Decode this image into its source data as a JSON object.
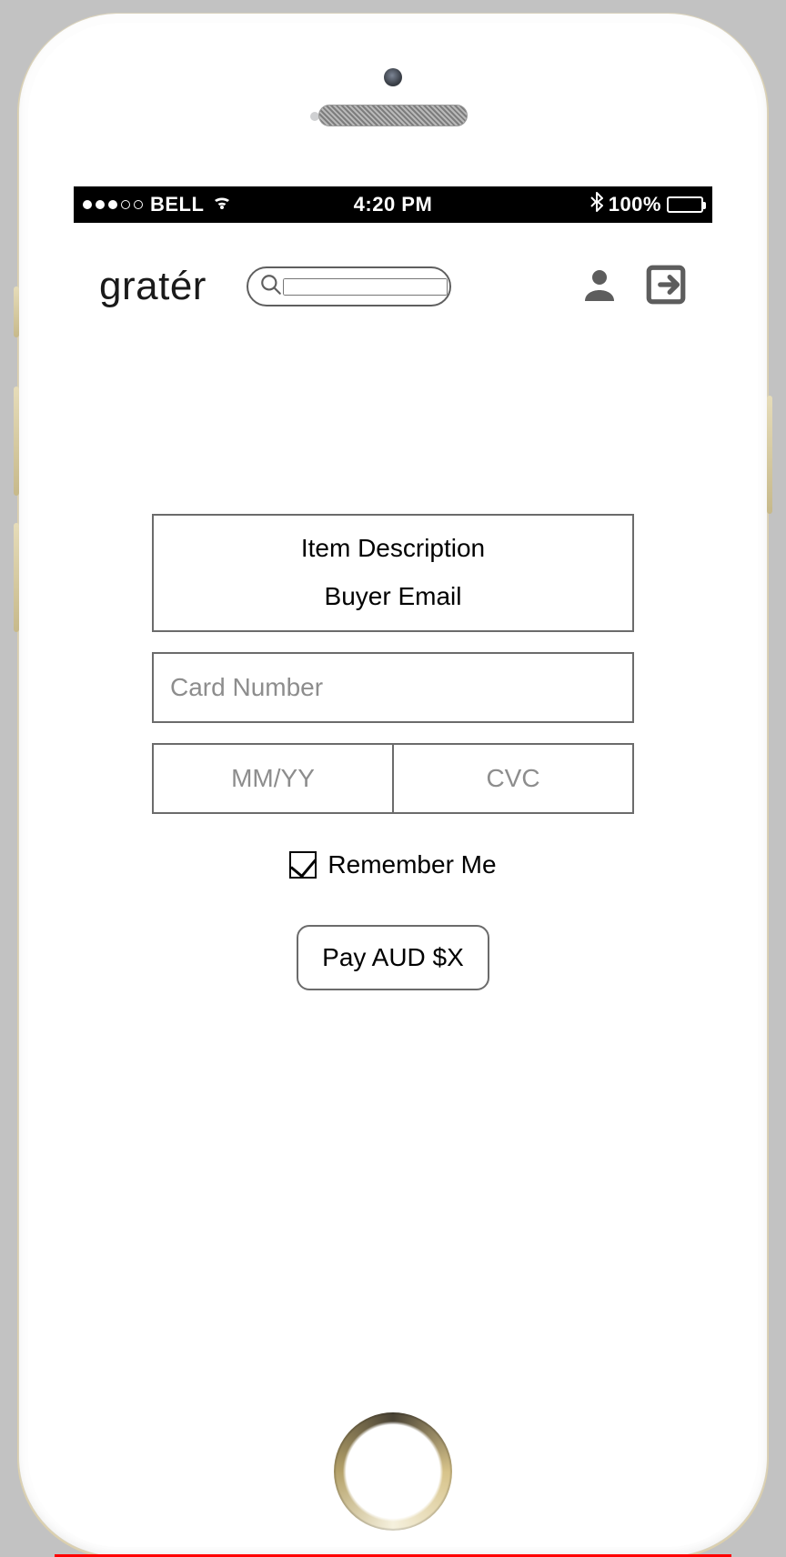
{
  "status": {
    "carrier": "BELL",
    "time": "4:20 PM",
    "battery_pct": "100%",
    "signal_filled": 3,
    "signal_total": 5
  },
  "header": {
    "brand": "gratér",
    "search_placeholder": "",
    "icons": {
      "user": "person-icon",
      "exit": "exit-icon",
      "search": "search-icon",
      "wifi": "wifi-icon",
      "bluetooth": "bluetooth-icon"
    }
  },
  "checkout": {
    "info_line_1": "Item Description",
    "info_line_2": "Buyer Email",
    "card_placeholder": "Card Number",
    "expiry_placeholder": "MM/YY",
    "cvc_placeholder": "CVC",
    "remember_label": "Remember Me",
    "remember_checked": true,
    "pay_label": "Pay AUD $X"
  }
}
